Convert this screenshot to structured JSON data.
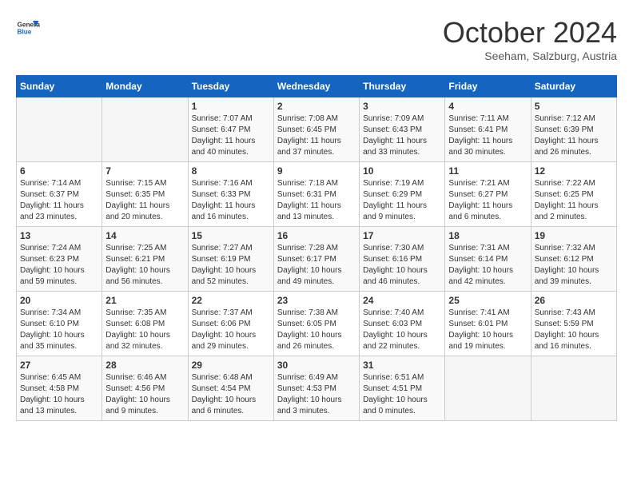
{
  "header": {
    "logo": {
      "general": "General",
      "blue": "Blue"
    },
    "title": "October 2024",
    "subtitle": "Seeham, Salzburg, Austria"
  },
  "weekdays": [
    "Sunday",
    "Monday",
    "Tuesday",
    "Wednesday",
    "Thursday",
    "Friday",
    "Saturday"
  ],
  "weeks": [
    [
      {
        "day": "",
        "info": ""
      },
      {
        "day": "",
        "info": ""
      },
      {
        "day": "1",
        "info": "Sunrise: 7:07 AM\nSunset: 6:47 PM\nDaylight: 11 hours and 40 minutes."
      },
      {
        "day": "2",
        "info": "Sunrise: 7:08 AM\nSunset: 6:45 PM\nDaylight: 11 hours and 37 minutes."
      },
      {
        "day": "3",
        "info": "Sunrise: 7:09 AM\nSunset: 6:43 PM\nDaylight: 11 hours and 33 minutes."
      },
      {
        "day": "4",
        "info": "Sunrise: 7:11 AM\nSunset: 6:41 PM\nDaylight: 11 hours and 30 minutes."
      },
      {
        "day": "5",
        "info": "Sunrise: 7:12 AM\nSunset: 6:39 PM\nDaylight: 11 hours and 26 minutes."
      }
    ],
    [
      {
        "day": "6",
        "info": "Sunrise: 7:14 AM\nSunset: 6:37 PM\nDaylight: 11 hours and 23 minutes."
      },
      {
        "day": "7",
        "info": "Sunrise: 7:15 AM\nSunset: 6:35 PM\nDaylight: 11 hours and 20 minutes."
      },
      {
        "day": "8",
        "info": "Sunrise: 7:16 AM\nSunset: 6:33 PM\nDaylight: 11 hours and 16 minutes."
      },
      {
        "day": "9",
        "info": "Sunrise: 7:18 AM\nSunset: 6:31 PM\nDaylight: 11 hours and 13 minutes."
      },
      {
        "day": "10",
        "info": "Sunrise: 7:19 AM\nSunset: 6:29 PM\nDaylight: 11 hours and 9 minutes."
      },
      {
        "day": "11",
        "info": "Sunrise: 7:21 AM\nSunset: 6:27 PM\nDaylight: 11 hours and 6 minutes."
      },
      {
        "day": "12",
        "info": "Sunrise: 7:22 AM\nSunset: 6:25 PM\nDaylight: 11 hours and 2 minutes."
      }
    ],
    [
      {
        "day": "13",
        "info": "Sunrise: 7:24 AM\nSunset: 6:23 PM\nDaylight: 10 hours and 59 minutes."
      },
      {
        "day": "14",
        "info": "Sunrise: 7:25 AM\nSunset: 6:21 PM\nDaylight: 10 hours and 56 minutes."
      },
      {
        "day": "15",
        "info": "Sunrise: 7:27 AM\nSunset: 6:19 PM\nDaylight: 10 hours and 52 minutes."
      },
      {
        "day": "16",
        "info": "Sunrise: 7:28 AM\nSunset: 6:17 PM\nDaylight: 10 hours and 49 minutes."
      },
      {
        "day": "17",
        "info": "Sunrise: 7:30 AM\nSunset: 6:16 PM\nDaylight: 10 hours and 46 minutes."
      },
      {
        "day": "18",
        "info": "Sunrise: 7:31 AM\nSunset: 6:14 PM\nDaylight: 10 hours and 42 minutes."
      },
      {
        "day": "19",
        "info": "Sunrise: 7:32 AM\nSunset: 6:12 PM\nDaylight: 10 hours and 39 minutes."
      }
    ],
    [
      {
        "day": "20",
        "info": "Sunrise: 7:34 AM\nSunset: 6:10 PM\nDaylight: 10 hours and 35 minutes."
      },
      {
        "day": "21",
        "info": "Sunrise: 7:35 AM\nSunset: 6:08 PM\nDaylight: 10 hours and 32 minutes."
      },
      {
        "day": "22",
        "info": "Sunrise: 7:37 AM\nSunset: 6:06 PM\nDaylight: 10 hours and 29 minutes."
      },
      {
        "day": "23",
        "info": "Sunrise: 7:38 AM\nSunset: 6:05 PM\nDaylight: 10 hours and 26 minutes."
      },
      {
        "day": "24",
        "info": "Sunrise: 7:40 AM\nSunset: 6:03 PM\nDaylight: 10 hours and 22 minutes."
      },
      {
        "day": "25",
        "info": "Sunrise: 7:41 AM\nSunset: 6:01 PM\nDaylight: 10 hours and 19 minutes."
      },
      {
        "day": "26",
        "info": "Sunrise: 7:43 AM\nSunset: 5:59 PM\nDaylight: 10 hours and 16 minutes."
      }
    ],
    [
      {
        "day": "27",
        "info": "Sunrise: 6:45 AM\nSunset: 4:58 PM\nDaylight: 10 hours and 13 minutes."
      },
      {
        "day": "28",
        "info": "Sunrise: 6:46 AM\nSunset: 4:56 PM\nDaylight: 10 hours and 9 minutes."
      },
      {
        "day": "29",
        "info": "Sunrise: 6:48 AM\nSunset: 4:54 PM\nDaylight: 10 hours and 6 minutes."
      },
      {
        "day": "30",
        "info": "Sunrise: 6:49 AM\nSunset: 4:53 PM\nDaylight: 10 hours and 3 minutes."
      },
      {
        "day": "31",
        "info": "Sunrise: 6:51 AM\nSunset: 4:51 PM\nDaylight: 10 hours and 0 minutes."
      },
      {
        "day": "",
        "info": ""
      },
      {
        "day": "",
        "info": ""
      }
    ]
  ]
}
